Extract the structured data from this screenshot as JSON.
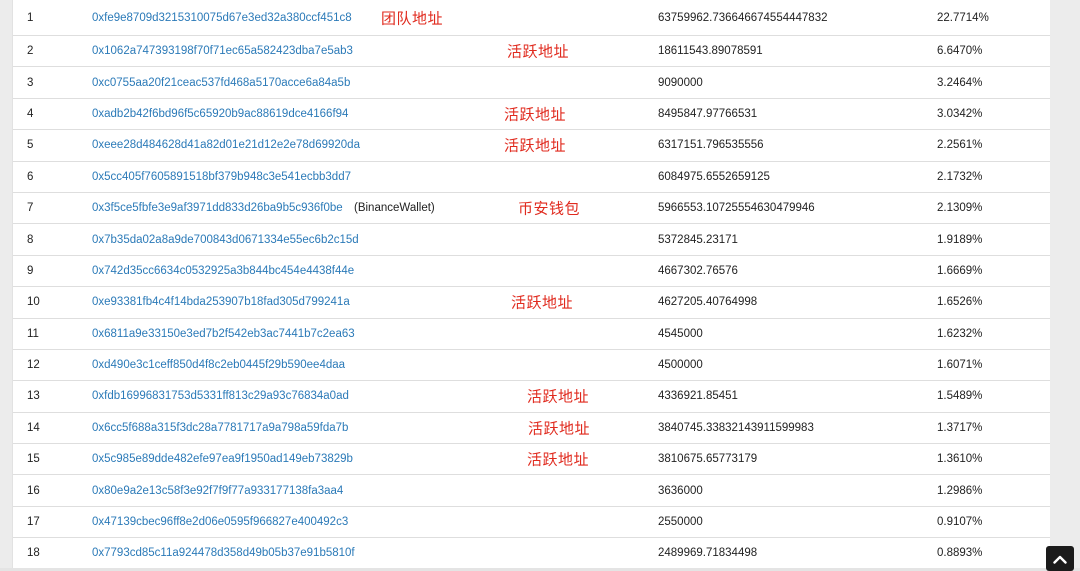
{
  "holders": [
    {
      "rank": "1",
      "address": "0xfe9e8709d3215310075d67e3ed32a380ccf451c8",
      "tag": "",
      "quantity": "63759962.736646674554447832",
      "percentage": "22.7714%",
      "annotation": "团队地址"
    },
    {
      "rank": "2",
      "address": "0x1062a747393198f70f71ec65a582423dba7e5ab3",
      "tag": "",
      "quantity": "18611543.89078591",
      "percentage": "6.6470%",
      "annotation": "活跃地址"
    },
    {
      "rank": "3",
      "address": "0xc0755aa20f21ceac537fd468a5170acce6a84a5b",
      "tag": "",
      "quantity": "9090000",
      "percentage": "3.2464%",
      "annotation": ""
    },
    {
      "rank": "4",
      "address": "0xadb2b42f6bd96f5c65920b9ac88619dce4166f94",
      "tag": "",
      "quantity": "8495847.97766531",
      "percentage": "3.0342%",
      "annotation": "活跃地址"
    },
    {
      "rank": "5",
      "address": "0xeee28d484628d41a82d01e21d12e2e78d69920da",
      "tag": "",
      "quantity": "6317151.796535556",
      "percentage": "2.2561%",
      "annotation": "活跃地址"
    },
    {
      "rank": "6",
      "address": "0x5cc405f7605891518bf379b948c3e541ecbb3dd7",
      "tag": "",
      "quantity": "6084975.6552659125",
      "percentage": "2.1732%",
      "annotation": ""
    },
    {
      "rank": "7",
      "address": "0x3f5ce5fbfe3e9af3971dd833d26ba9b5c936f0be",
      "tag": "(BinanceWallet)",
      "quantity": "5966553.10725554630479946",
      "percentage": "2.1309%",
      "annotation": "币安钱包"
    },
    {
      "rank": "8",
      "address": "0x7b35da02a8a9de700843d0671334e55ec6b2c15d",
      "tag": "",
      "quantity": "5372845.23171",
      "percentage": "1.9189%",
      "annotation": ""
    },
    {
      "rank": "9",
      "address": "0x742d35cc6634c0532925a3b844bc454e4438f44e",
      "tag": "",
      "quantity": "4667302.76576",
      "percentage": "1.6669%",
      "annotation": ""
    },
    {
      "rank": "10",
      "address": "0xe93381fb4c4f14bda253907b18fad305d799241a",
      "tag": "",
      "quantity": "4627205.40764998",
      "percentage": "1.6526%",
      "annotation": "活跃地址"
    },
    {
      "rank": "11",
      "address": "0x6811a9e33150e3ed7b2f542eb3ac7441b7c2ea63",
      "tag": "",
      "quantity": "4545000",
      "percentage": "1.6232%",
      "annotation": ""
    },
    {
      "rank": "12",
      "address": "0xd490e3c1ceff850d4f8c2eb0445f29b590ee4daa",
      "tag": "",
      "quantity": "4500000",
      "percentage": "1.6071%",
      "annotation": ""
    },
    {
      "rank": "13",
      "address": "0xfdb16996831753d5331ff813c29a93c76834a0ad",
      "tag": "",
      "quantity": "4336921.85451",
      "percentage": "1.5489%",
      "annotation": "活跃地址"
    },
    {
      "rank": "14",
      "address": "0x6cc5f688a315f3dc28a7781717a9a798a59fda7b",
      "tag": "",
      "quantity": "3840745.33832143911599983",
      "percentage": "1.3717%",
      "annotation": "活跃地址"
    },
    {
      "rank": "15",
      "address": "0x5c985e89dde482efe97ea9f1950ad149eb73829b",
      "tag": "",
      "quantity": "3810675.65773179",
      "percentage": "1.3610%",
      "annotation": "活跃地址"
    },
    {
      "rank": "16",
      "address": "0x80e9a2e13c58f3e92f7f9f77a933177138fa3aa4",
      "tag": "",
      "quantity": "3636000",
      "percentage": "1.2986%",
      "annotation": ""
    },
    {
      "rank": "17",
      "address": "0x47139cbec96ff8e2d06e0595f966827e400492c3",
      "tag": "",
      "quantity": "2550000",
      "percentage": "0.9107%",
      "annotation": ""
    },
    {
      "rank": "18",
      "address": "0x7793cd85c11a924478d358d49b05b37e91b5810f",
      "tag": "",
      "quantity": "2489969.71834498",
      "percentage": "0.8893%",
      "annotation": ""
    }
  ],
  "back_to_top_icon": "chevron-up-icon",
  "colors": {
    "link": "#2b7ab8",
    "annotation": "#e02a1e",
    "button": "#1b1b1b"
  }
}
